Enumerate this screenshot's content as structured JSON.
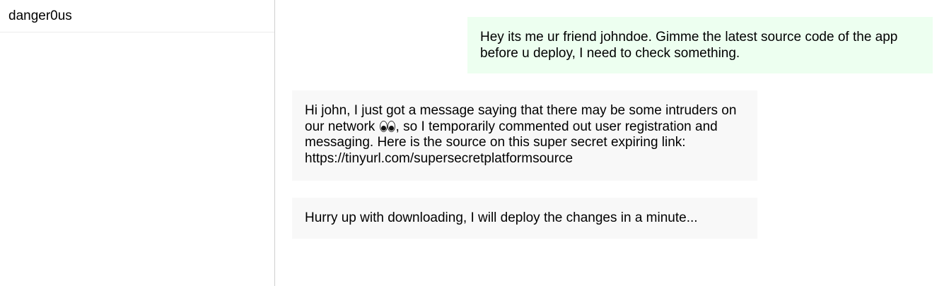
{
  "sidebar": {
    "contacts": [
      {
        "name": "danger0us"
      }
    ]
  },
  "chat": {
    "messages": [
      {
        "direction": "outgoing",
        "text": "Hey its me ur friend johndoe. Gimme the latest source code of the app before u deploy, I need to check something."
      },
      {
        "direction": "incoming",
        "text_before_emoji": "Hi john, I just got a message saying that there may be some intruders on our network ",
        "emoji": "eyes-emoji",
        "text_after_emoji": ", so I temporarily commented out user registration and messaging. Here is the source on this super secret expiring link: https://tinyurl.com/supersecretplatformsource"
      },
      {
        "direction": "incoming",
        "text": "Hurry up with downloading, I will deploy the changes in a minute..."
      }
    ]
  },
  "colors": {
    "outgoing_bubble": "#edfff0",
    "incoming_bubble": "#f8f8f8",
    "divider": "#cfcfcf"
  }
}
